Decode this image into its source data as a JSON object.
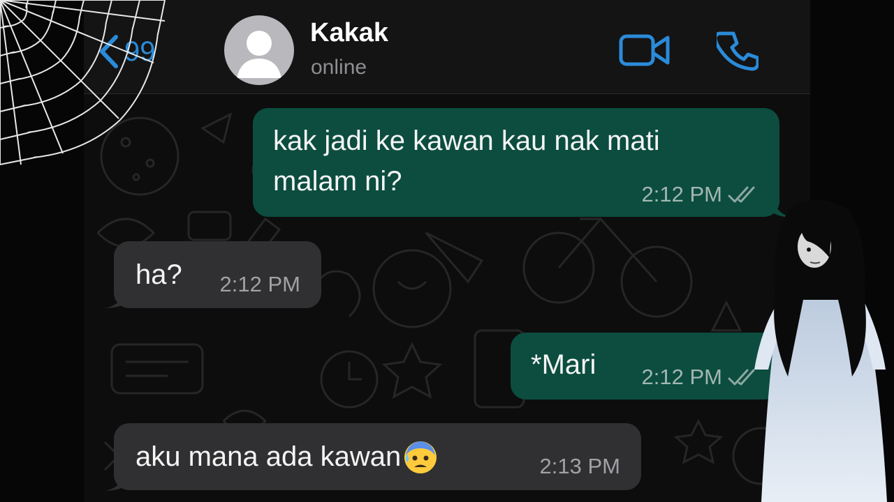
{
  "header": {
    "back_count": "99",
    "contact_name": "Kakak",
    "contact_status": "online"
  },
  "messages": [
    {
      "direction": "outgoing",
      "text_line1": "kak jadi ke kawan kau nak mati",
      "text_line2": "malam ni?",
      "time": "2:12 PM",
      "status": "read"
    },
    {
      "direction": "incoming",
      "text": "ha?",
      "time": "2:12 PM"
    },
    {
      "direction": "outgoing",
      "text": "*Mari",
      "time": "2:12 PM",
      "status": "read"
    },
    {
      "direction": "incoming",
      "text": "aku mana ada kawan",
      "emoji": "anxious-face-with-sweat",
      "time": "2:13 PM"
    }
  ],
  "colors": {
    "accent": "#2a8bd9",
    "outgoing_bubble": "#0c4d3f",
    "incoming_bubble": "#303032",
    "header_bg": "#141414",
    "chat_bg": "#0d0d0d"
  },
  "icons": {
    "back": "chevron-left-icon",
    "video": "video-camera-icon",
    "call": "phone-icon",
    "read_receipt": "double-check-icon",
    "decoration_left": "spider-web-icon",
    "decoration_right": "ghost-figure"
  }
}
